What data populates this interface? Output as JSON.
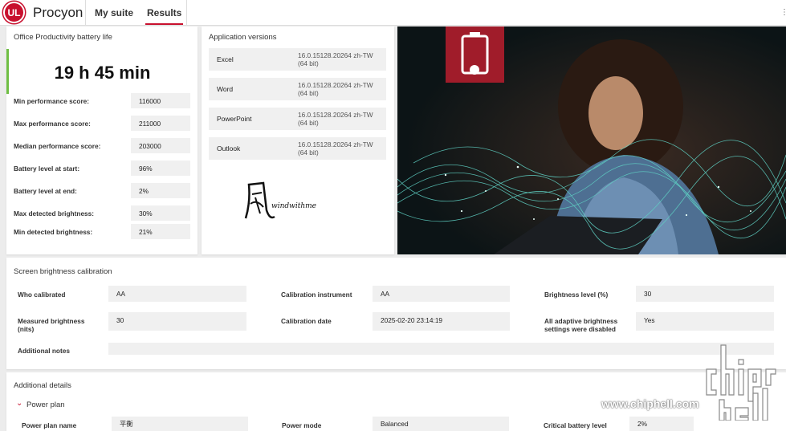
{
  "app": {
    "logo_text": "UL",
    "brand": "Procyon",
    "tabs": [
      {
        "label": "My suite",
        "active": false
      },
      {
        "label": "Results",
        "active": true
      }
    ],
    "accent_color": "#c8102e"
  },
  "battery_card": {
    "title": "Office Productivity battery life",
    "result": "19 h 45 min",
    "rows": [
      {
        "label": "Min performance score:",
        "value": "116000"
      },
      {
        "label": "Max performance score:",
        "value": "211000"
      },
      {
        "label": "Median performance score:",
        "value": "203000"
      },
      {
        "label": "Battery level at start:",
        "value": "96%"
      },
      {
        "label": "Battery level at end:",
        "value": "2%"
      },
      {
        "label": "Max detected brightness:",
        "value": "30%"
      },
      {
        "label": "Min detected brightness:",
        "value": "21%"
      }
    ]
  },
  "versions_card": {
    "title": "Application versions",
    "apps": [
      {
        "name": "Excel",
        "version": "16.0.15128.20264 zh-TW (64 bit)"
      },
      {
        "name": "Word",
        "version": "16.0.15128.20264 zh-TW (64 bit)"
      },
      {
        "name": "PowerPoint",
        "version": "16.0.15128.20264 zh-TW (64 bit)"
      },
      {
        "name": "Outlook",
        "version": "16.0.15128.20264 zh-TW (64 bit)"
      }
    ],
    "signature_text": "windwithme"
  },
  "calibration": {
    "title": "Screen brightness calibration",
    "who_label": "Who calibrated",
    "who_value": "AA",
    "instrument_label": "Calibration instrument",
    "instrument_value": "AA",
    "level_label": "Brightness level (%)",
    "level_value": "30",
    "measured_label": "Measured brightness (nits)",
    "measured_value": "30",
    "date_label": "Calibration date",
    "date_value": "2025-02-20 23:14:19",
    "adaptive_label": "All adaptive brightness settings were disabled",
    "adaptive_value": "Yes",
    "notes_label": "Additional notes",
    "notes_value": ""
  },
  "details": {
    "title": "Additional details",
    "section": "Power plan",
    "plan_name_label": "Power plan name",
    "plan_name_value": "平衡",
    "power_mode_label": "Power mode",
    "power_mode_value": "Balanced",
    "critical_label": "Critical battery level",
    "critical_value": "2%"
  },
  "watermark": "www.chiphell.com"
}
